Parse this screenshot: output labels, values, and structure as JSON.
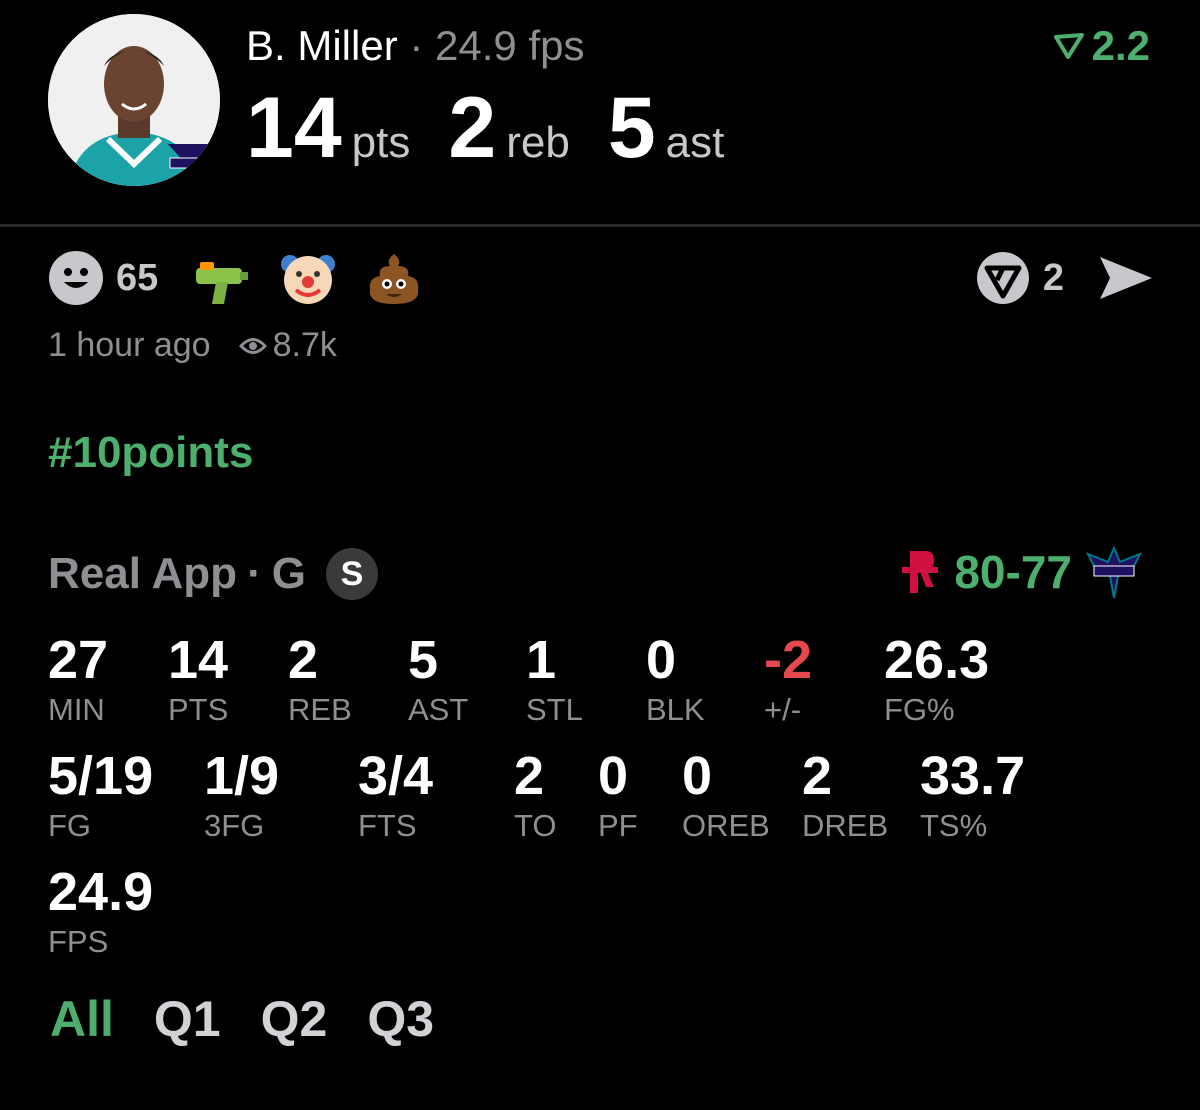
{
  "header": {
    "player_name": "B. Miller",
    "separator": "·",
    "fps_text": "24.9 fps",
    "boost_value": "2.2",
    "pts": "14",
    "pts_unit": "pts",
    "reb": "2",
    "reb_unit": "reb",
    "ast": "5",
    "ast_unit": "ast"
  },
  "reactions": {
    "smile_count": "65",
    "emojis": [
      "water-gun",
      "clown-face",
      "pile-of-poo"
    ],
    "share_count": "2"
  },
  "meta": {
    "time_ago": "1 hour ago",
    "views": "8.7k"
  },
  "hashtag": "#10points",
  "game": {
    "source": "Real App",
    "dot": "·",
    "position": "G",
    "badge": "S",
    "score": "80-77"
  },
  "stats_row1": [
    {
      "value": "27",
      "label": "MIN"
    },
    {
      "value": "14",
      "label": "PTS"
    },
    {
      "value": "2",
      "label": "REB"
    },
    {
      "value": "5",
      "label": "AST"
    },
    {
      "value": "1",
      "label": "STL"
    },
    {
      "value": "0",
      "label": "BLK"
    },
    {
      "value": "-2",
      "label": "+/-"
    },
    {
      "value": "26.3",
      "label": "FG%"
    }
  ],
  "stats_row2": [
    {
      "value": "5/19",
      "label": "FG"
    },
    {
      "value": "1/9",
      "label": "3FG"
    },
    {
      "value": "3/4",
      "label": "FTS"
    },
    {
      "value": "2",
      "label": "TO"
    },
    {
      "value": "0",
      "label": "PF"
    },
    {
      "value": "0",
      "label": "OREB"
    },
    {
      "value": "2",
      "label": "DREB"
    },
    {
      "value": "33.7",
      "label": "TS%"
    }
  ],
  "stats_row3": [
    {
      "value": "24.9",
      "label": "FPS"
    }
  ],
  "tabs": [
    "All",
    "Q1",
    "Q2",
    "Q3"
  ],
  "colors": {
    "accent_green": "#4caf6e",
    "negative_red": "#e5484d",
    "muted_gray": "#8e8e93",
    "background": "#000000"
  }
}
